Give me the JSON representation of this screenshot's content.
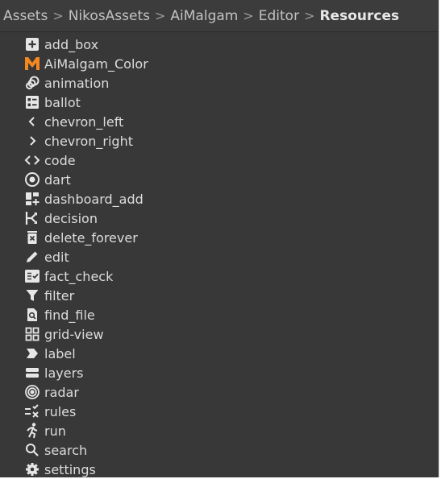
{
  "breadcrumb": [
    "Assets",
    "NikosAssets",
    "AiMalgam",
    "Editor",
    "Resources"
  ],
  "separator": ">",
  "items": [
    {
      "label": "add_box",
      "icon": "add-box-icon"
    },
    {
      "label": "AiMalgam_Color",
      "icon": "aimalgam-logo-icon"
    },
    {
      "label": "animation",
      "icon": "animation-icon"
    },
    {
      "label": "ballot",
      "icon": "ballot-icon"
    },
    {
      "label": "chevron_left",
      "icon": "chevron-left-icon"
    },
    {
      "label": "chevron_right",
      "icon": "chevron-right-icon"
    },
    {
      "label": "code",
      "icon": "code-icon"
    },
    {
      "label": "dart",
      "icon": "dart-icon"
    },
    {
      "label": "dashboard_add",
      "icon": "dashboard-add-icon"
    },
    {
      "label": "decision",
      "icon": "decision-icon"
    },
    {
      "label": "delete_forever",
      "icon": "delete-forever-icon"
    },
    {
      "label": "edit",
      "icon": "edit-icon"
    },
    {
      "label": "fact_check",
      "icon": "fact-check-icon"
    },
    {
      "label": "filter",
      "icon": "filter-icon"
    },
    {
      "label": "find_file",
      "icon": "find-file-icon"
    },
    {
      "label": "grid-view",
      "icon": "grid-view-icon"
    },
    {
      "label": "label",
      "icon": "label-icon"
    },
    {
      "label": "layers",
      "icon": "layers-icon"
    },
    {
      "label": "radar",
      "icon": "radar-icon"
    },
    {
      "label": "rules",
      "icon": "rules-icon"
    },
    {
      "label": "run",
      "icon": "run-icon"
    },
    {
      "label": "search",
      "icon": "search-icon"
    },
    {
      "label": "settings",
      "icon": "settings-icon"
    }
  ],
  "colors": {
    "background": "#383838",
    "text": "#dcdcdc",
    "icon": "#e6e6e6",
    "logo_orange": "#f5871f"
  }
}
